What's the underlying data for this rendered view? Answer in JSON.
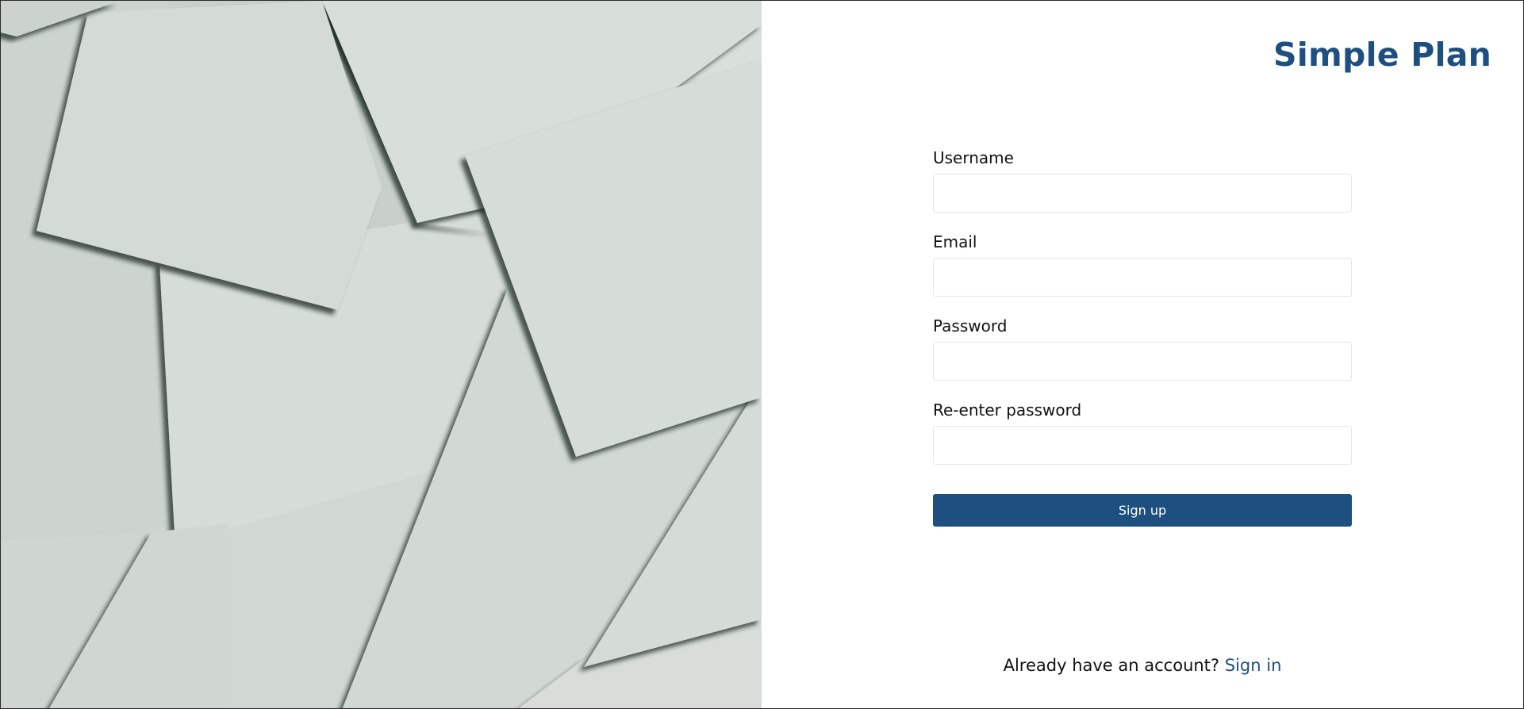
{
  "brand": {
    "name": "Simple Plan",
    "color": "#1d4f80"
  },
  "form": {
    "fields": [
      {
        "label": "Username",
        "value": "",
        "type": "text"
      },
      {
        "label": "Email",
        "value": "",
        "type": "email"
      },
      {
        "label": "Password",
        "value": "",
        "type": "password"
      },
      {
        "label": "Re-enter password",
        "value": "",
        "type": "password"
      }
    ],
    "submit_label": "Sign up"
  },
  "footer": {
    "prompt": "Already have an account?",
    "link_label": "Sign in"
  },
  "colors": {
    "primary": "#1d4f80",
    "hero_paper": "#d3d9d4"
  }
}
